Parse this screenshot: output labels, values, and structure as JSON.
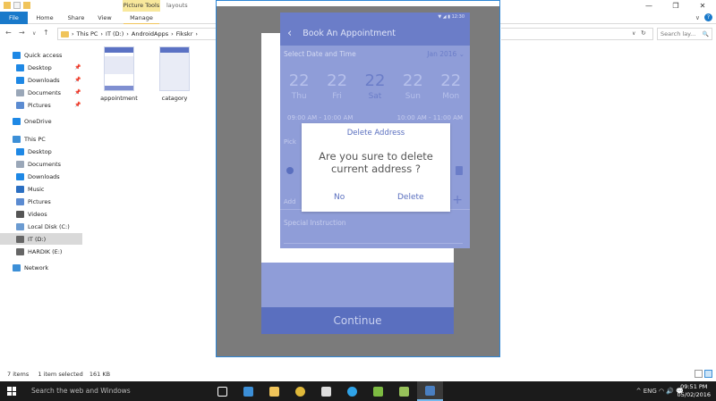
{
  "explorer": {
    "context_group": "Picture Tools",
    "context_title": "layouts",
    "window_controls": [
      "—",
      "❐",
      "✕"
    ],
    "tabs": [
      "File",
      "Home",
      "Share",
      "View",
      "Manage"
    ],
    "ribbon_right": [
      "∨",
      "?"
    ],
    "nav_buttons": [
      "←",
      "→",
      "∨",
      "↑"
    ],
    "breadcrumb": [
      "This PC",
      "IT (D:)",
      "AndroidApps",
      "Fikskr"
    ],
    "breadcrumb_sep": "›",
    "search_placeholder": "Search lay...",
    "search_icon": "🔍",
    "refresh_icon": "↻",
    "dropdown_icon": "∨",
    "pin_icon": "📌",
    "sidebar": [
      {
        "label": "Quick access",
        "icon": "star-icon",
        "color": "#1e88e5",
        "pinned": false
      },
      {
        "label": "Desktop",
        "icon": "desktop-icon",
        "color": "#1e88e5",
        "pinned": true
      },
      {
        "label": "Downloads",
        "icon": "downloads-icon",
        "color": "#1e88e5",
        "pinned": true
      },
      {
        "label": "Documents",
        "icon": "documents-icon",
        "color": "#9aa7b8",
        "pinned": true
      },
      {
        "label": "Pictures",
        "icon": "pictures-icon",
        "color": "#5b8bd1",
        "pinned": true
      },
      {
        "label": "OneDrive",
        "icon": "cloud-icon",
        "color": "#1e88e5",
        "pinned": false
      },
      {
        "label": "This PC",
        "icon": "computer-icon",
        "color": "#3c8fd7",
        "pinned": false
      },
      {
        "label": "Desktop",
        "icon": "desktop-icon",
        "color": "#1e88e5",
        "pinned": false
      },
      {
        "label": "Documents",
        "icon": "documents-icon",
        "color": "#9aa7b8",
        "pinned": false
      },
      {
        "label": "Downloads",
        "icon": "downloads-icon",
        "color": "#1e88e5",
        "pinned": false
      },
      {
        "label": "Music",
        "icon": "music-icon",
        "color": "#2b6fc2",
        "pinned": false
      },
      {
        "label": "Pictures",
        "icon": "pictures-icon",
        "color": "#5b8bd1",
        "pinned": false
      },
      {
        "label": "Videos",
        "icon": "videos-icon",
        "color": "#555555",
        "pinned": false
      },
      {
        "label": "Local Disk (C:)",
        "icon": "disk-icon",
        "color": "#6b9bd1",
        "pinned": false
      },
      {
        "label": "IT (D:)",
        "icon": "disk-icon",
        "color": "#666666",
        "pinned": false,
        "selected": true
      },
      {
        "label": "HARDIK (E:)",
        "icon": "disk-icon",
        "color": "#666666",
        "pinned": false
      },
      {
        "label": "Network",
        "icon": "network-icon",
        "color": "#3c8fd7",
        "pinned": false
      }
    ],
    "files": [
      {
        "label": "appointment"
      },
      {
        "label": "catagory"
      }
    ],
    "status": {
      "items": "7 items",
      "selected": "1 item selected",
      "size": "161 KB"
    }
  },
  "phone": {
    "status_bar": "▼ ◢ ▮ 12:30",
    "back_icon": "‹",
    "title": "Book An Appointment",
    "section_date": "Select Date and Time",
    "month": "Jan 2016 ⌄",
    "days": [
      {
        "num": "22",
        "wd": "Thu"
      },
      {
        "num": "22",
        "wd": "Fri"
      },
      {
        "num": "22",
        "wd": "Sat",
        "selected": true
      },
      {
        "num": "22",
        "wd": "Sun"
      },
      {
        "num": "22",
        "wd": "Mon"
      }
    ],
    "time_left": "09:00 AM - 10:00 AM",
    "time_right": "10:00 AM - 11:00 AM",
    "pick_label": "Pick",
    "add_label": "Add",
    "plus_label": "+",
    "special_instruction": "Special Instruction",
    "continue": "Continue"
  },
  "dialog": {
    "title": "Delete Address",
    "message_line1": "Are you sure to delete",
    "message_line2": "current address ?",
    "no": "No",
    "delete": "Delete"
  },
  "taskbar": {
    "search": "Search the web and Windows",
    "apps": [
      {
        "name": "task-view-icon",
        "color": "#ffffff"
      },
      {
        "name": "edge-icon",
        "color": "#3c8fd7"
      },
      {
        "name": "file-explorer-icon",
        "color": "#f0c45a"
      },
      {
        "name": "chrome-icon",
        "color": "#e0b93a"
      },
      {
        "name": "store-icon",
        "color": "#dddddd"
      },
      {
        "name": "skype-icon",
        "color": "#2fa3e8"
      },
      {
        "name": "android-studio-icon",
        "color": "#7dbb42"
      },
      {
        "name": "android-icon",
        "color": "#97c15a"
      },
      {
        "name": "photos-icon",
        "color": "#4a7fc1",
        "active": true
      }
    ],
    "tray": "^  ENG  ◠  🔊  💬",
    "time": "09:51 PM",
    "date": "05/02/2016"
  }
}
